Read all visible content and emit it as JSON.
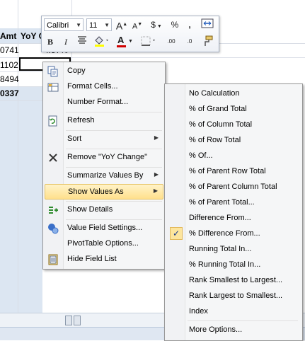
{
  "sheet": {
    "header_amt": "Amt",
    "header_yoy": "YoY C",
    "rows": [
      {
        "a": "0741",
        "b": "4.57%"
      },
      {
        "a": "1102",
        "b": ""
      },
      {
        "a": "8494",
        "b": ""
      },
      {
        "a": "0337",
        "b": ""
      }
    ]
  },
  "mini_toolbar": {
    "font": "Calibri",
    "size": "11",
    "grow_font": "A",
    "shrink_font": "A",
    "currency": "$",
    "percent": "%",
    "comma": ",",
    "bold": "B",
    "italic": "I",
    "font_color": "A",
    "increase_decimal": ".00",
    "decrease_decimal": ".0"
  },
  "context_menu": {
    "items": [
      {
        "label": "Copy",
        "icon": "copy-icon"
      },
      {
        "label": "Format Cells...",
        "icon": "format-cells-icon"
      },
      {
        "label": "Number Format...",
        "icon": ""
      },
      {
        "label": "Refresh",
        "icon": "refresh-icon"
      },
      {
        "label": "Sort",
        "icon": "",
        "submenu": true
      },
      {
        "label": "Remove \"YoY Change\"",
        "icon": "remove-x-icon"
      },
      {
        "label": "Summarize Values By",
        "icon": "",
        "submenu": true
      },
      {
        "label": "Show Values As",
        "icon": "",
        "submenu": true,
        "highlighted": true
      },
      {
        "label": "Show Details",
        "icon": "show-details-icon"
      },
      {
        "label": "Value Field Settings...",
        "icon": "field-settings-icon"
      },
      {
        "label": "PivotTable Options...",
        "icon": ""
      },
      {
        "label": "Hide Field List",
        "icon": "field-list-icon"
      }
    ]
  },
  "submenu": {
    "items": [
      {
        "label": "No Calculation"
      },
      {
        "label": "% of Grand Total"
      },
      {
        "label": "% of Column Total"
      },
      {
        "label": "% of Row Total"
      },
      {
        "label": "% Of..."
      },
      {
        "label": "% of Parent Row Total"
      },
      {
        "label": "% of Parent Column Total"
      },
      {
        "label": "% of Parent Total..."
      },
      {
        "label": "Difference From..."
      },
      {
        "label": "% Difference From...",
        "checked": true
      },
      {
        "label": "Running Total In..."
      },
      {
        "label": "% Running Total In..."
      },
      {
        "label": "Rank Smallest to Largest..."
      },
      {
        "label": "Rank Largest to Smallest..."
      },
      {
        "label": "Index"
      },
      {
        "label": "More Options..."
      }
    ],
    "check_mark": "✓"
  },
  "colors": {
    "highlight": "#ffe08c",
    "header_fill": "#dbe5f1"
  }
}
